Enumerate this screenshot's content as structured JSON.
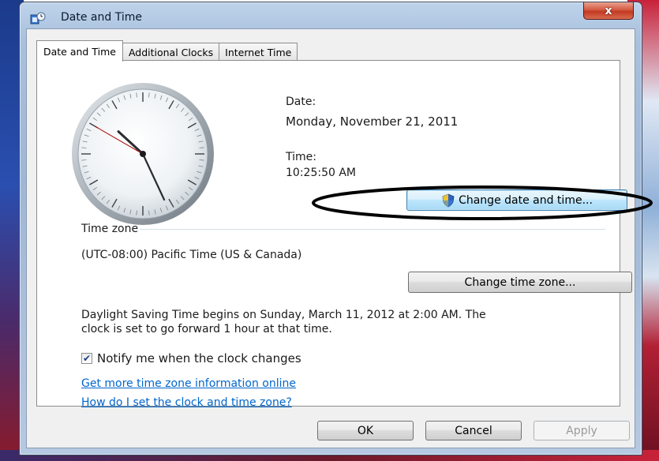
{
  "window": {
    "title": "Date and Time",
    "close_label": "x"
  },
  "tabs": [
    {
      "label": "Date and Time",
      "active": true
    },
    {
      "label": "Additional Clocks",
      "active": false
    },
    {
      "label": "Internet Time",
      "active": false
    }
  ],
  "datetime": {
    "date_label": "Date:",
    "date_value": "Monday, November 21, 2011",
    "time_label": "Time:",
    "time_value": "10:25:50 AM",
    "change_button": "Change date and time..."
  },
  "timezone": {
    "section_label": "Time zone",
    "value": "(UTC-08:00) Pacific Time (US & Canada)",
    "change_button": "Change time zone..."
  },
  "dst": {
    "line1": "Daylight Saving Time begins on Sunday, March 11, 2012 at 2:00 AM. The",
    "line2": "clock is set to go forward 1 hour at that time."
  },
  "notify": {
    "label": "Notify me when the clock changes",
    "checked": true,
    "checkmark": "✔"
  },
  "links": {
    "more_info": "Get more time zone information online",
    "how_to": "How do I set the clock and time zone?"
  },
  "footer": {
    "ok": "OK",
    "cancel": "Cancel",
    "apply": "Apply"
  },
  "clock_reading": {
    "hour": 10,
    "minute": 25,
    "second": 50
  },
  "colors": {
    "link": "#0066cc",
    "focus_button": "#3c7fb1",
    "close_button": "#c23a22",
    "annotation": "#000000"
  }
}
